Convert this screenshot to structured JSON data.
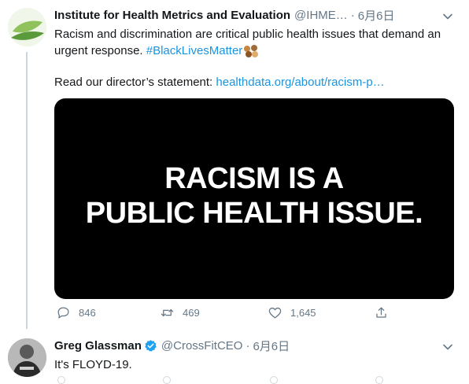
{
  "tweet1": {
    "name": "Institute for Health Metrics and Evaluation",
    "handle": "@IHME…",
    "separator": "·",
    "date": "6月6日",
    "text_main": "Racism and discrimination are critical public health issues that demand an urgent response.",
    "hashtag": "#BlackLivesMatter",
    "read_label": "Read our director’s statement:",
    "link": "healthdata.org/about/racism-p…",
    "card": {
      "line1": "RACISM IS A",
      "line2": "PUBLIC HEALTH ISSUE."
    },
    "counts": {
      "replies": "846",
      "retweets": "469",
      "likes": "1,645"
    }
  },
  "tweet2": {
    "name": "Greg Glassman",
    "handle": "@CrossFitCEO",
    "separator": "·",
    "date": "6月6日",
    "text": "It's FLOYD-19."
  },
  "colors": {
    "link": "#1b95e0",
    "secondary_text": "#657786",
    "verified": "#1da1f2",
    "thread_line": "#ccd6dd"
  },
  "icons": [
    "reply-icon",
    "retweet-icon",
    "like-icon",
    "share-icon",
    "verified-badge-icon",
    "caret-down-icon",
    "raised-fist-emoji"
  ]
}
